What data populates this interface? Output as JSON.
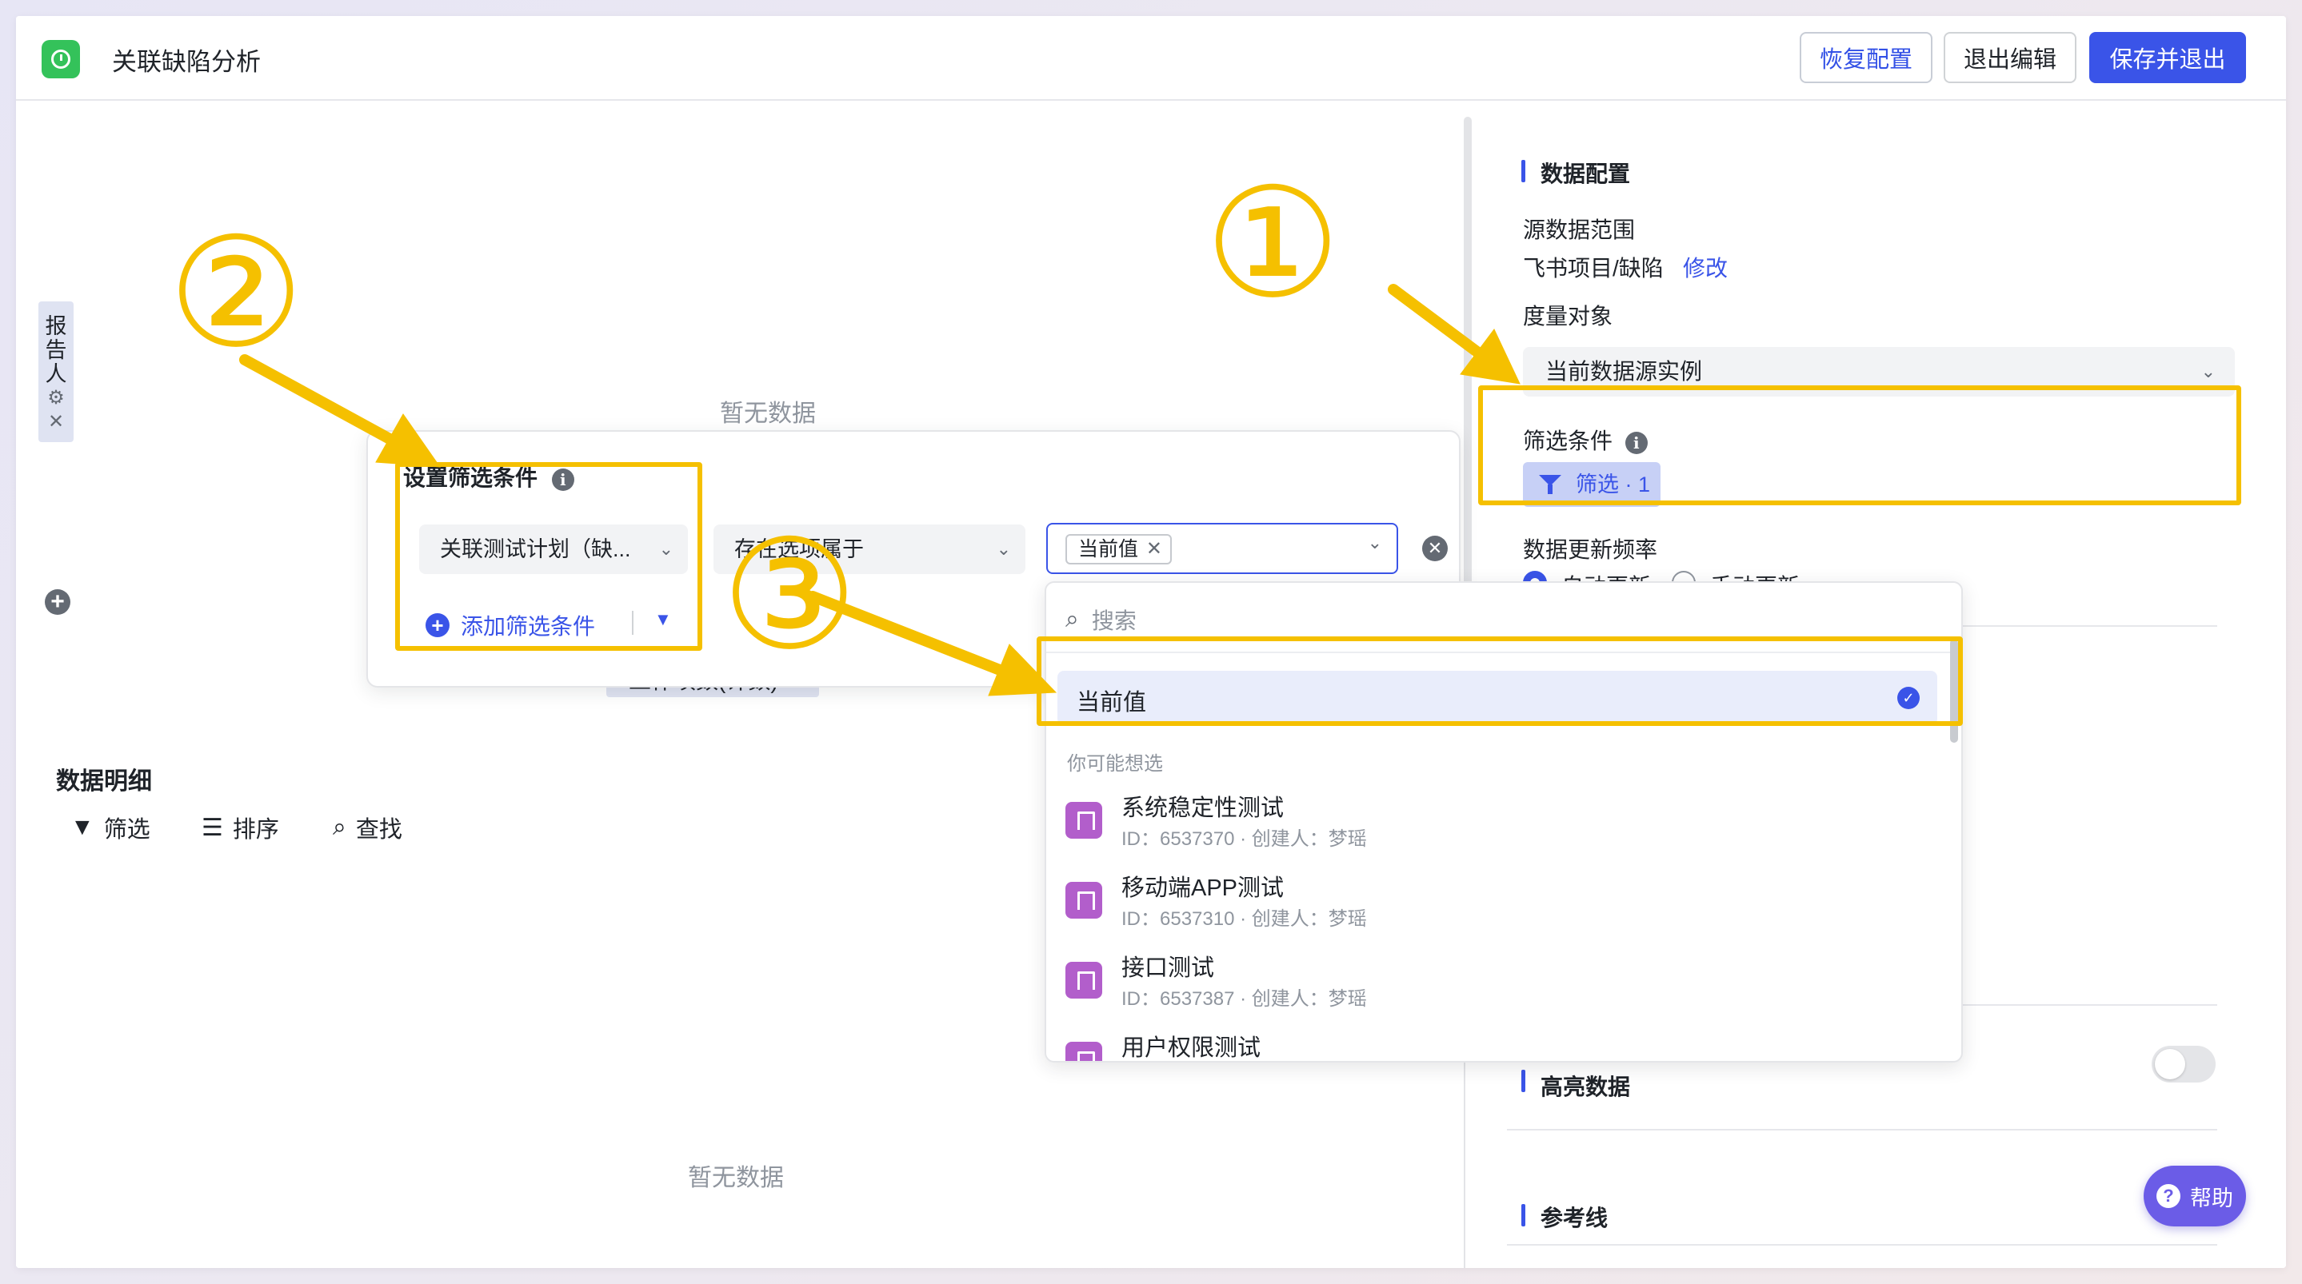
{
  "header": {
    "title": "关联缺陷分析",
    "restore_label": "恢复配置",
    "exit_edit_label": "退出编辑",
    "save_exit_label": "保存并退出"
  },
  "canvas": {
    "no_data_top": "暂无数据",
    "no_data_bottom": "暂无数据",
    "vertical_tag": "报告人",
    "vertical_tag_glyphs": [
      "报",
      "告",
      "人"
    ],
    "behind_chip": "工作项数(计数)",
    "details_title": "数据明细",
    "tools": {
      "filter": "筛选",
      "sort": "排序",
      "find": "查找"
    }
  },
  "filter_popup": {
    "title": "设置筛选条件",
    "field_value": "关联测试计划（缺...",
    "operator_value": "存在选项属于",
    "value_chip": "当前值",
    "add_condition": "添加筛选条件"
  },
  "dropdown": {
    "search_placeholder": "搜索",
    "selected_item": "当前值",
    "group_label": "你可能想选",
    "items": [
      {
        "name": "系统稳定性测试",
        "meta": "ID：6537370 · 创建人：梦瑶"
      },
      {
        "name": "移动端APP测试",
        "meta": "ID：6537310 · 创建人：梦瑶"
      },
      {
        "name": "接口测试",
        "meta": "ID：6537387 · 创建人：梦瑶"
      },
      {
        "name": "用户权限测试",
        "meta": ""
      }
    ]
  },
  "right_panel": {
    "section_data_config": "数据配置",
    "source_range_label": "源数据范围",
    "source_range_value": "飞书项目/缺陷",
    "modify_link": "修改",
    "measure_label": "度量对象",
    "measure_value": "当前数据源实例",
    "filter_label": "筛选条件",
    "filter_button": "筛选 · 1",
    "update_freq_label": "数据更新频率",
    "auto_update": "自动更新",
    "manual_update": "手动更新",
    "highlight_label": "高亮数据",
    "reference_line": "参考线"
  },
  "help_label": "帮助",
  "annotations": {
    "one": "①",
    "two": "②",
    "three": "③"
  },
  "colors": {
    "accent": "#3a54e8",
    "highlight": "#f5c000",
    "app_icon": "#34c25a",
    "help": "#6b5ce7"
  }
}
